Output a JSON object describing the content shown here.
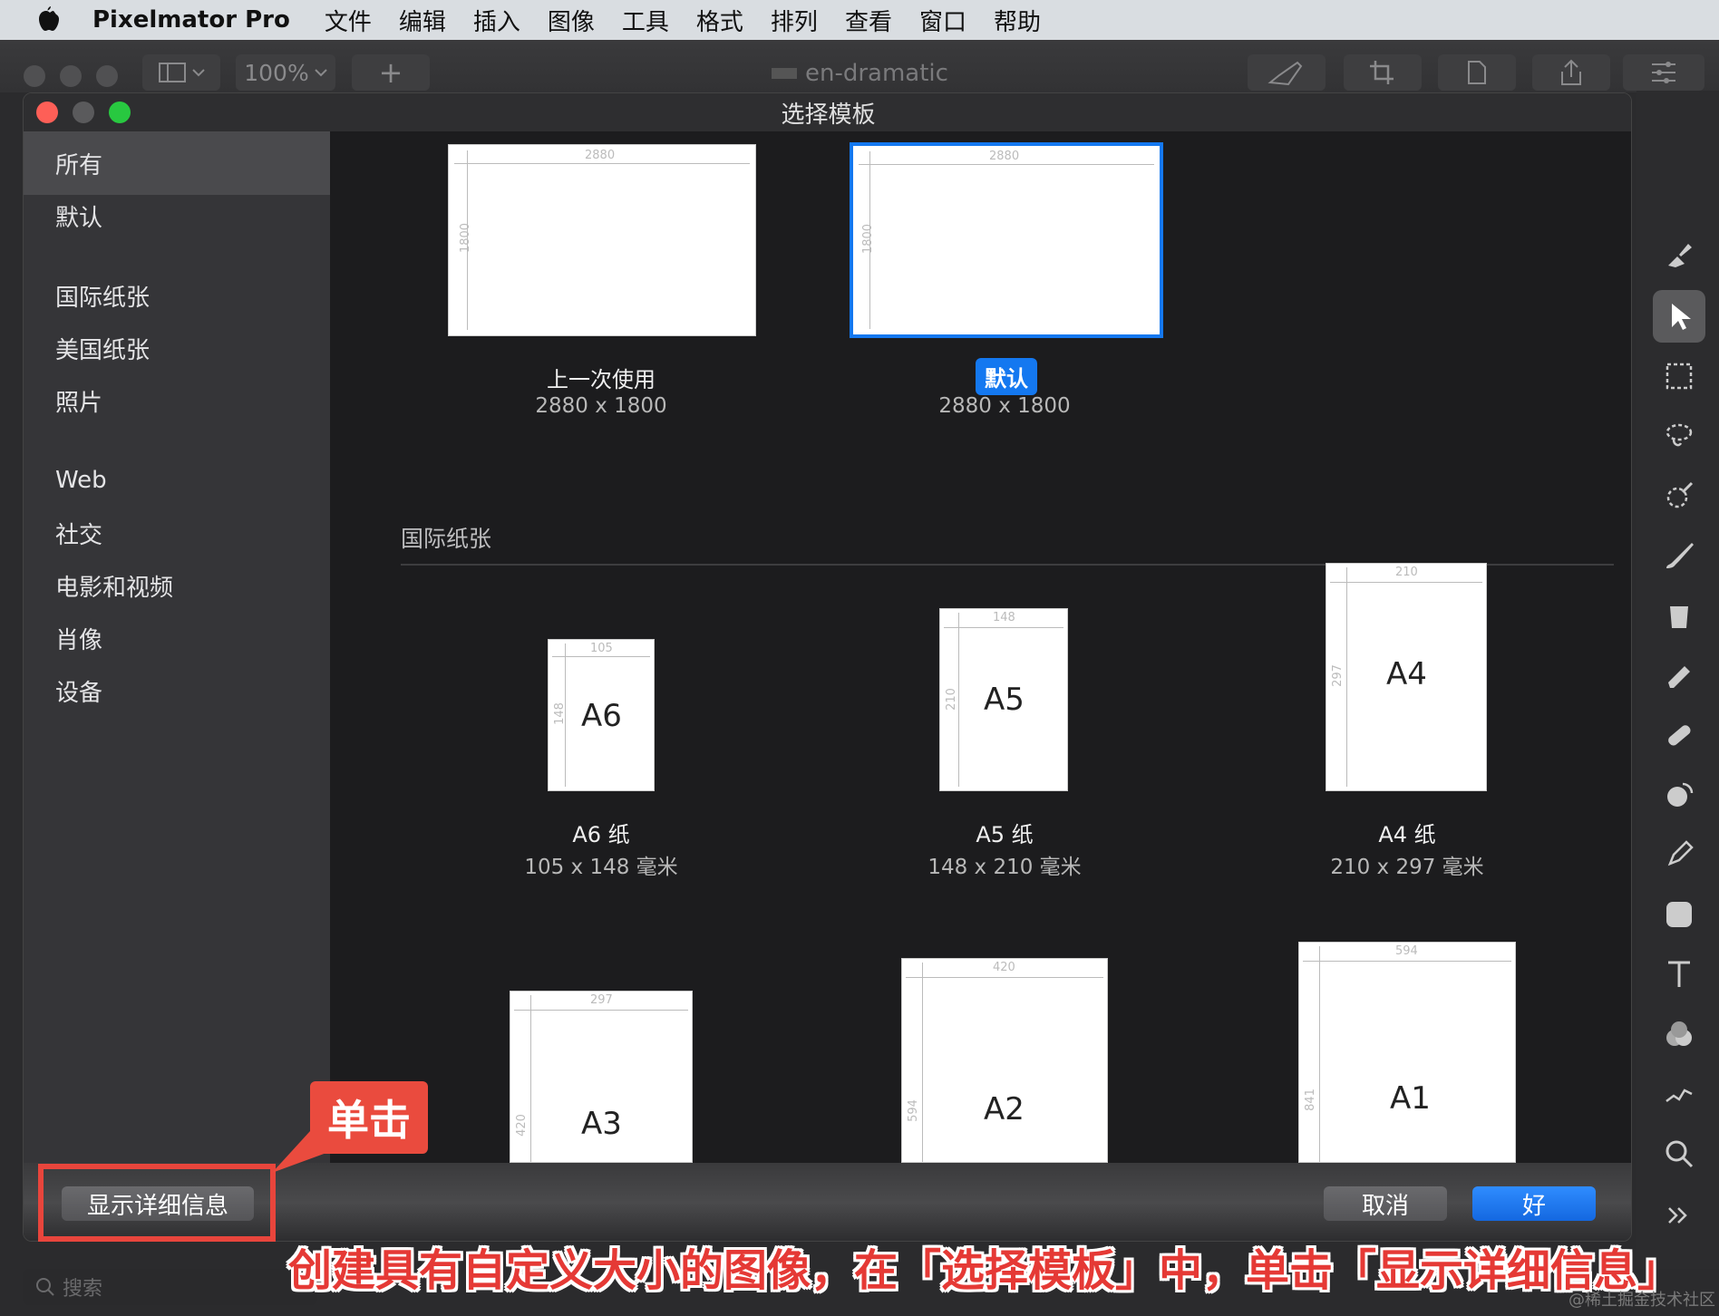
{
  "menubar": {
    "app": "Pixelmator Pro",
    "items": [
      "文件",
      "编辑",
      "插入",
      "图像",
      "工具",
      "格式",
      "排列",
      "查看",
      "窗口",
      "帮助"
    ]
  },
  "toolbar": {
    "zoom": "100%",
    "add": "+",
    "doc_title": "en-dramatic"
  },
  "dialog": {
    "title": "选择模板",
    "sidebar": [
      "所有",
      "默认",
      "国际纸张",
      "美国纸张",
      "照片",
      "Web",
      "社交",
      "电影和视频",
      "肖像",
      "设备"
    ],
    "recent": [
      {
        "name": "上一次使用",
        "size": "2880 x 1800",
        "w": "2880",
        "h": "1800",
        "selected": false
      },
      {
        "name": "默认",
        "size": "2880 x 1800",
        "w": "2880",
        "h": "1800",
        "selected": true
      }
    ],
    "section_title": "国际纸张",
    "papers": [
      {
        "label": "A6",
        "name": "A6 纸",
        "size": "105 x 148 毫米",
        "w": "105",
        "h": "148"
      },
      {
        "label": "A5",
        "name": "A5 纸",
        "size": "148 x 210 毫米",
        "w": "148",
        "h": "210"
      },
      {
        "label": "A4",
        "name": "A4 纸",
        "size": "210 x 297 毫米",
        "w": "210",
        "h": "297"
      },
      {
        "label": "A3",
        "w": "297",
        "h": "420"
      },
      {
        "label": "A2",
        "w": "420",
        "h": "594"
      },
      {
        "label": "A1",
        "w": "594",
        "h": "841"
      }
    ],
    "details_button": "显示详细信息",
    "cancel_button": "取消",
    "ok_button": "好"
  },
  "search_placeholder": "搜索",
  "annotation": {
    "callout": "单击",
    "caption": "创建具有自定义大小的图像，在「选择模板」中，单击「显示详细信息」"
  },
  "watermark": "@稀土掘金技术社区",
  "colors": {
    "accent": "#1478f0",
    "annotation_red": "#e8453c"
  }
}
